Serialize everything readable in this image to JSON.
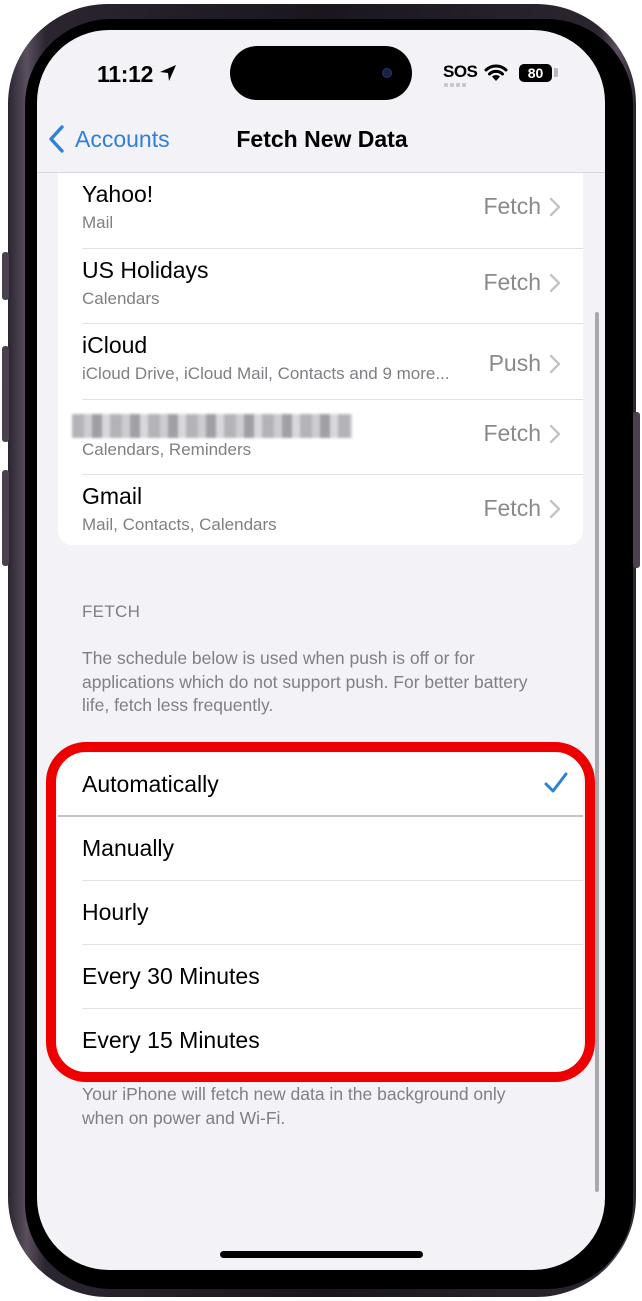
{
  "status_bar": {
    "time": "11:12",
    "location_icon": "location-arrow-icon",
    "carrier": "SOS",
    "wifi_icon": "wifi-icon",
    "battery_percent": "80"
  },
  "nav": {
    "back_label": "Accounts",
    "title": "Fetch New Data"
  },
  "accounts": [
    {
      "name": "Yahoo!",
      "services": "Mail",
      "value": "Fetch"
    },
    {
      "name": "US Holidays",
      "services": "Calendars",
      "value": "Fetch"
    },
    {
      "name": "iCloud",
      "services": "iCloud Drive, iCloud Mail, Contacts and 9 more...",
      "value": "Push"
    },
    {
      "name": "",
      "services": "Calendars, Reminders",
      "value": "Fetch",
      "redacted": true
    },
    {
      "name": "Gmail",
      "services": "Mail, Contacts, Calendars",
      "value": "Fetch"
    }
  ],
  "fetch_section": {
    "header": "FETCH",
    "description": "The schedule below is used when push is off or for applications which do not support push. For better battery life, fetch less frequently.",
    "options": [
      {
        "label": "Automatically",
        "selected": true
      },
      {
        "label": "Manually",
        "selected": false
      },
      {
        "label": "Hourly",
        "selected": false
      },
      {
        "label": "Every 30 Minutes",
        "selected": false
      },
      {
        "label": "Every 15 Minutes",
        "selected": false
      }
    ],
    "footer": "Your iPhone will fetch new data in the background only when on power and Wi-Fi."
  },
  "colors": {
    "accent": "#2f80d8",
    "highlight": "#ee0000",
    "background": "#f2f2f7"
  }
}
